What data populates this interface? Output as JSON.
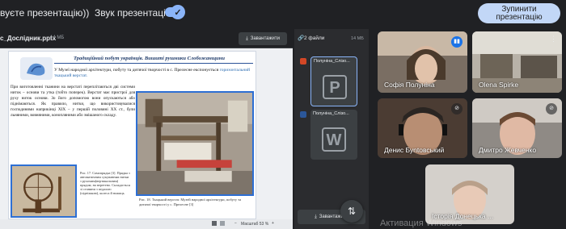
{
  "topbar": {
    "presenting_text": "вуєте презентацію))",
    "sound_label": "Звук презентації",
    "sound_on": true,
    "stop_button": [
      "Зупинити",
      "презентацію"
    ]
  },
  "doc": {
    "filename": "с_Дослідник.pptx",
    "size": "14 МБ",
    "download_label": "Завантажити",
    "zoom": "Масштаб 53 %",
    "page": {
      "title": "Традиційний побут українців. Вишиті рушники Слобожанщини",
      "intro_1": "У Музеї народної архітектури, побуту та дитячої творчості в с. Прелесне експонується",
      "intro_hl": "горизонтальний ткацький верстат.",
      "body": "При виготовленні тканини на верстаті переплітаються дві системи ниток – основи та утка (тобто поперек). Верстат має пристрої для руху ниток основи. Зо його допомогою вони опускаються або піднімаються. Як правило, нитки, що використовувалися господинями наприкінці ХІХ – у першій половині ХХ ст., були льняними, вовняними, конопляними або змішаного складу.",
      "wheel_caption": "Рис. 17. Самопрядка [3]. Прядка з автоматичним сукуванням нитки з рухомим(вертикальним) прядом; на веретено. Складається зі станини з педаллю (підніжкою), колеса й ножиць",
      "loom_caption": "Рис. 18. Ткацький верстат. Музей народної архітектури, побуту та дитячої творчості у с. Прелесне [3]"
    }
  },
  "files": {
    "count_label": "2 файли",
    "size": "14 МБ",
    "items": [
      {
        "title": "Полуніна_Слізо...",
        "letter": "P",
        "badge": "#d24726"
      },
      {
        "title": "Полуніна_Слізо...",
        "letter": "W",
        "badge": "#2b579a"
      }
    ],
    "download_label": "Завантажити"
  },
  "participants": [
    {
      "name": "Софія Полуніна",
      "speaking": true
    },
    {
      "name": "Olena Spirke",
      "speaking": false
    },
    {
      "name": "Денис Буntовський",
      "speaking": false
    },
    {
      "name": "Дмитро Жевченко",
      "speaking": false
    },
    {
      "name": "Історія Донецька ...",
      "speaking": false
    }
  ],
  "watermark": "Активация Windows"
}
